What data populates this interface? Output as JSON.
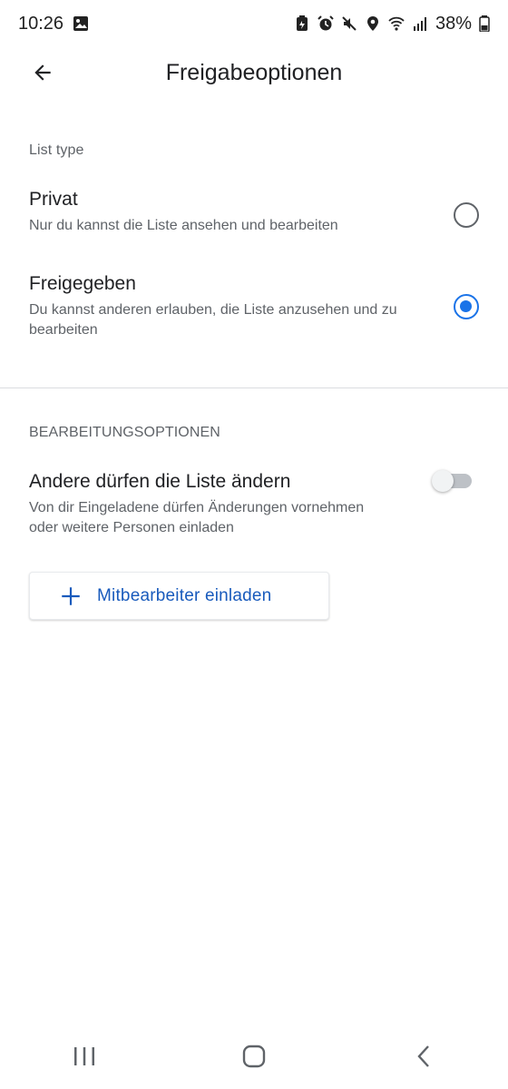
{
  "status_bar": {
    "time": "10:26",
    "battery": "38%",
    "icons": [
      "image-icon",
      "battery-saver-icon",
      "alarm-icon",
      "mute-icon",
      "location-icon",
      "wifi-icon",
      "signal-icon",
      "battery-icon"
    ]
  },
  "app_bar": {
    "title": "Freigabeoptionen",
    "back_icon": "arrow-left-icon"
  },
  "list_type": {
    "label": "List type",
    "options": [
      {
        "title": "Privat",
        "description": "Nur du kannst die Liste ansehen und bearbeiten",
        "selected": false
      },
      {
        "title": "Freigegeben",
        "description": "Du kannst anderen erlauben, die Liste anzusehen und zu bearbeiten",
        "selected": true
      }
    ]
  },
  "edit_options": {
    "label": "BEARBEITUNGSOPTIONEN",
    "toggle_title": "Andere dürfen die Liste ändern",
    "toggle_description": "Von dir Eingeladene dürfen Änderungen vornehmen oder weitere Personen einladen",
    "toggle_on": false,
    "invite_label": "Mitbearbeiter einladen"
  },
  "colors": {
    "accent": "#1a73e8",
    "invite_text": "#185abc",
    "secondary_text": "#5f6368"
  }
}
